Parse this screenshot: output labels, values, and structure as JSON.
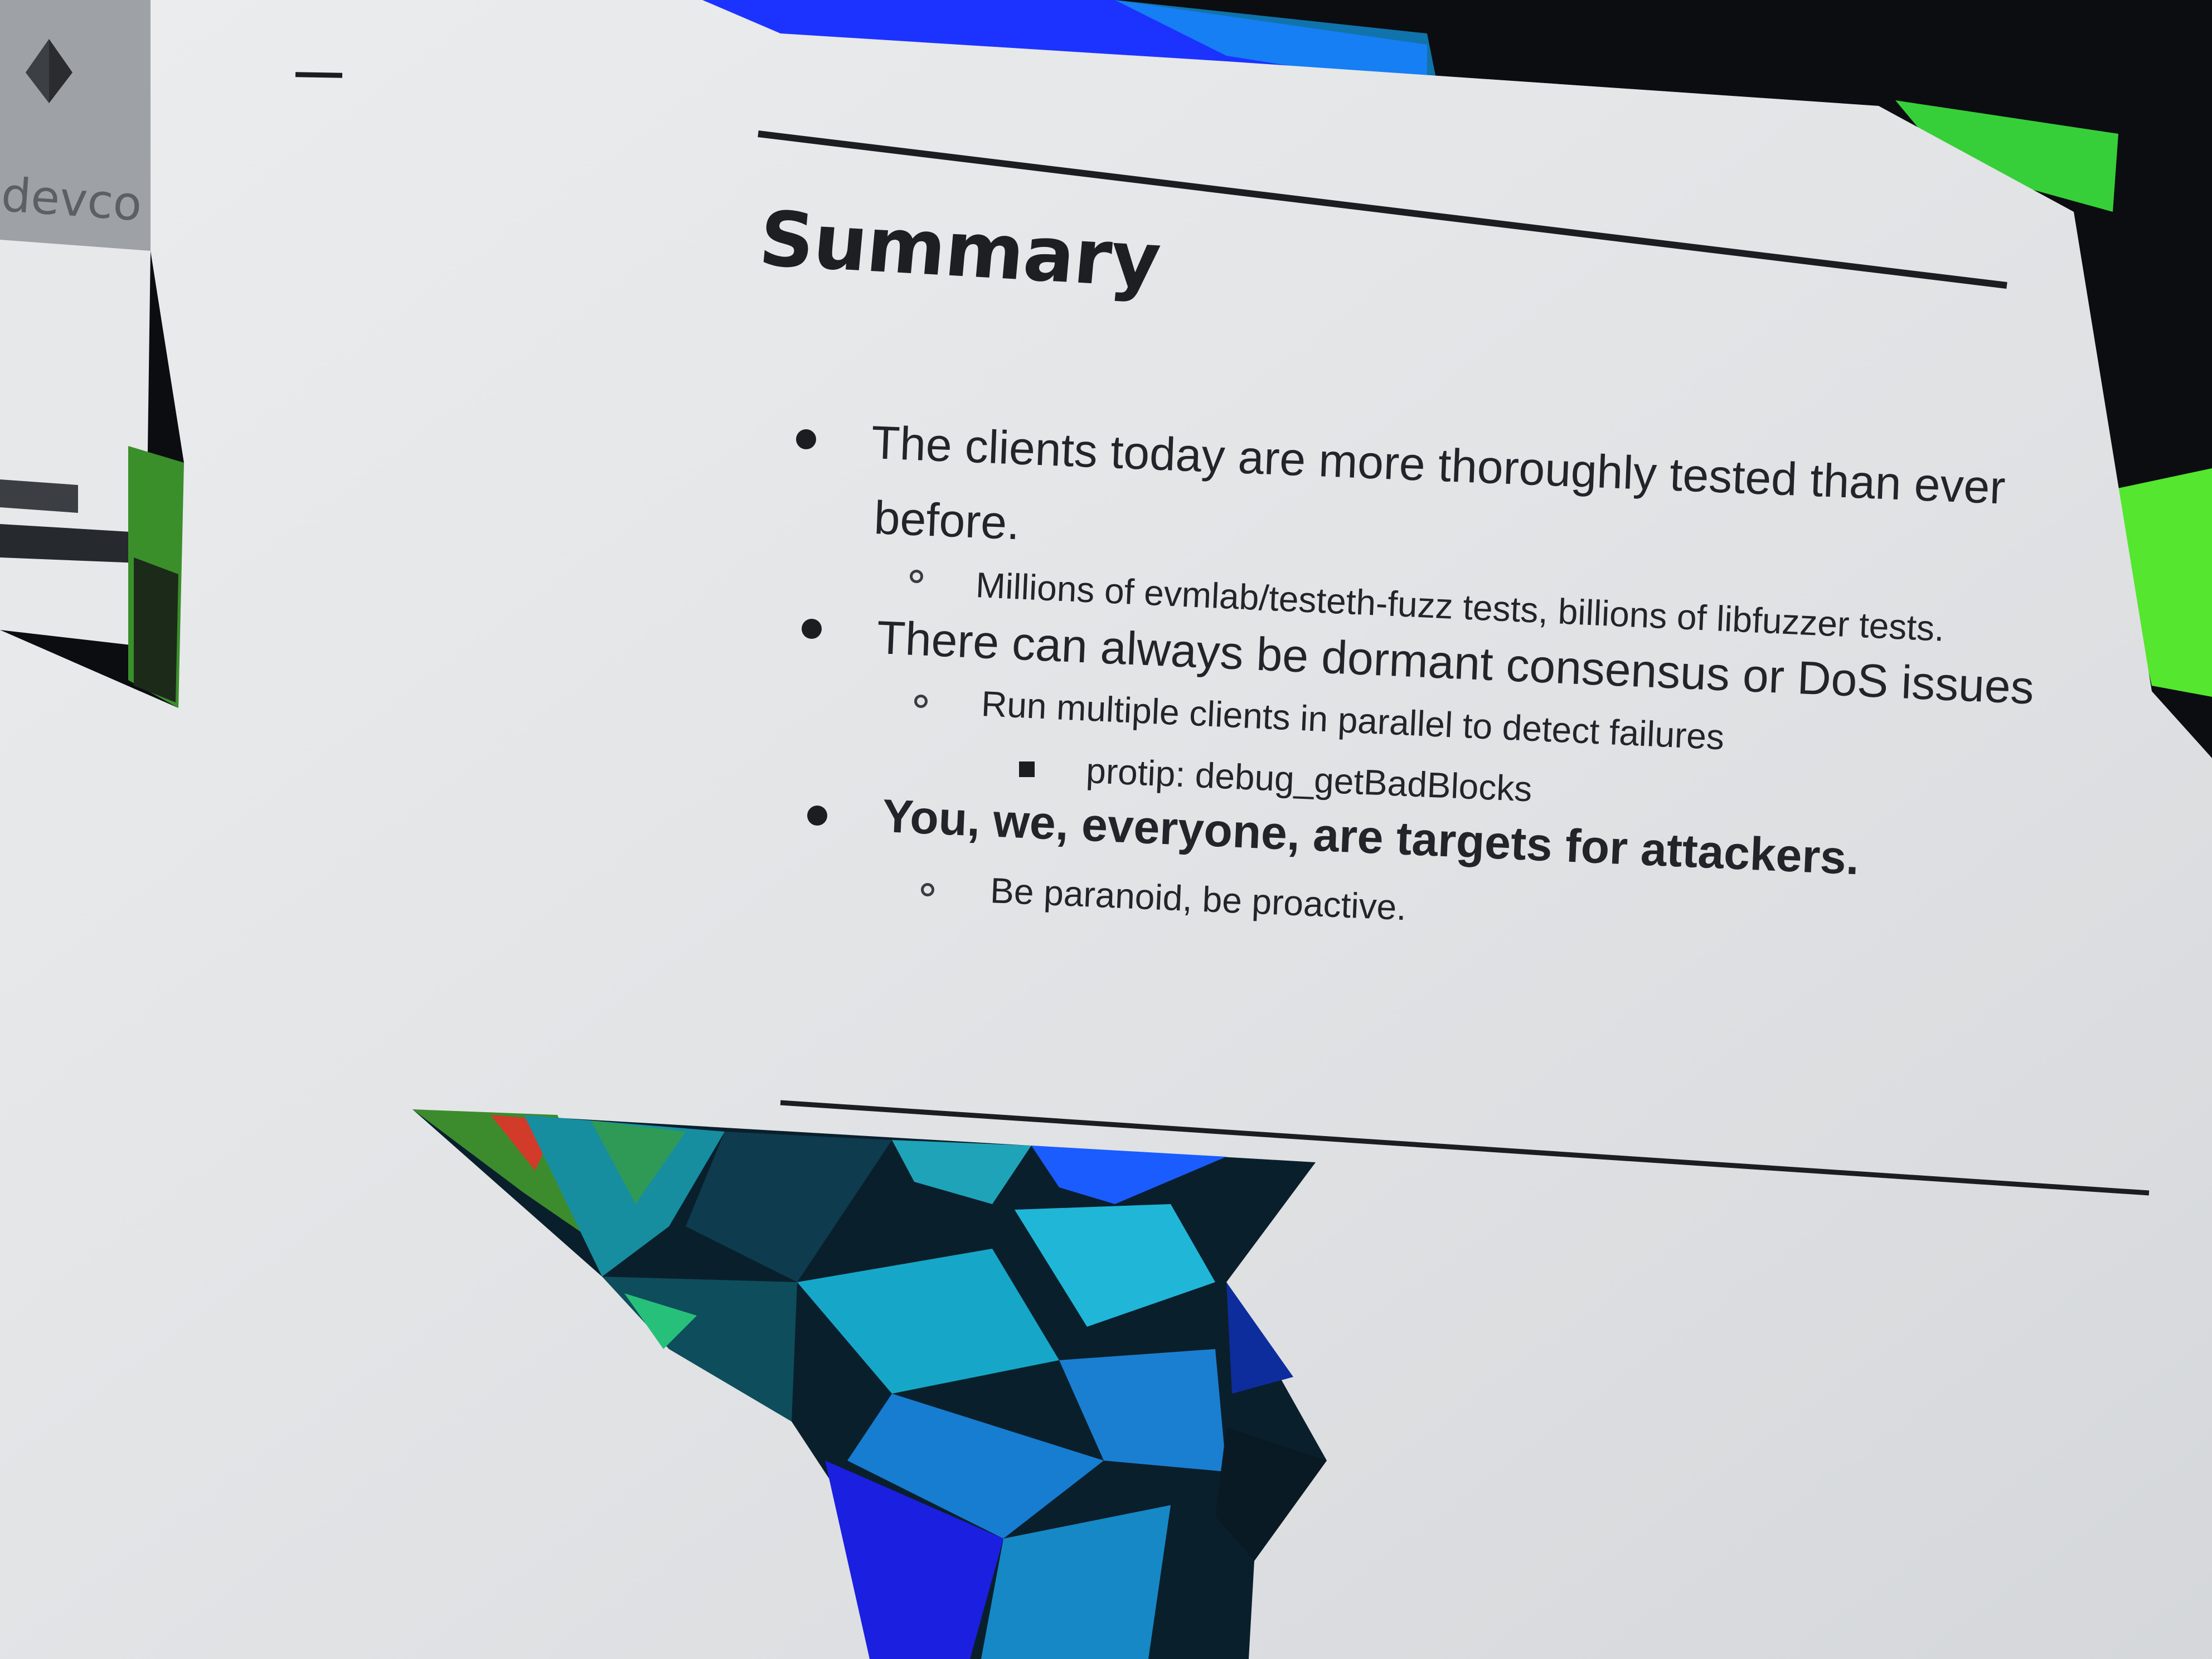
{
  "slide": {
    "title": "Summary",
    "bullets": [
      {
        "level": 1,
        "text_line1": "The clients today are more thoroughly tested than ever",
        "text_line2": "before."
      },
      {
        "level": 2,
        "text": "Millions of evmlab/testeth-fuzz tests, billions of libfuzzer tests."
      },
      {
        "level": 1,
        "text": "There can always be dormant consensus or DoS issues"
      },
      {
        "level": 2,
        "text": "Run multiple clients in parallel to detect failures"
      },
      {
        "level": 3,
        "text": "protip: debug_getBadBlocks"
      },
      {
        "level": 1,
        "text": "You, we, everyone, are targets for attackers."
      },
      {
        "level": 2,
        "text": "Be paranoid, be proactive."
      }
    ]
  },
  "logo": {
    "text": "devco",
    "icon": "ethereum-diamond-icon"
  },
  "colors": {
    "screen": "#e4e6e8",
    "text": "#222429",
    "rule": "#1b1d21",
    "accent_blue": "#1e3cff",
    "accent_cyan": "#1fb0d6",
    "accent_green": "#3fd83a"
  }
}
